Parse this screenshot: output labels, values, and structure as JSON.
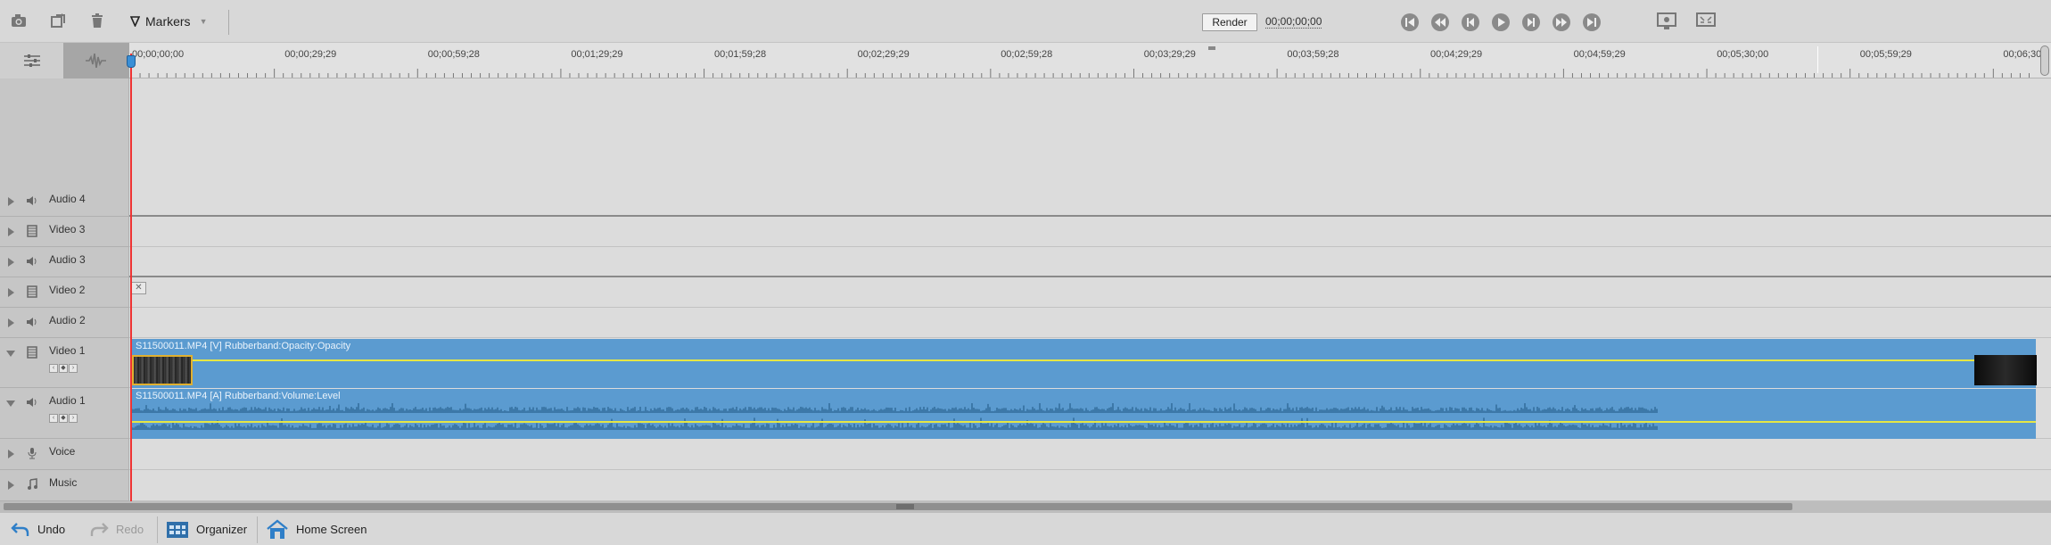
{
  "toolbar": {
    "markers_label": "Markers",
    "render_label": "Render",
    "timecode": "00;00;00;00"
  },
  "ruler": {
    "labels": [
      "00;00;00;00",
      "00;00;29;29",
      "00;00;59;28",
      "00;01;29;29",
      "00;01;59;28",
      "00;02;29;29",
      "00;02;59;28",
      "00;03;29;29",
      "00;03;59;28",
      "00;04;29;29",
      "00;04;59;29",
      "00;05;30;00",
      "00;05;59;29",
      "00;06;30;"
    ]
  },
  "tracks": {
    "audio4": "Audio 4",
    "video3": "Video 3",
    "audio3": "Audio 3",
    "video2": "Video 2",
    "audio2": "Audio 2",
    "video1": "Video 1",
    "audio1": "Audio 1",
    "voice": "Voice",
    "music": "Music"
  },
  "clips": {
    "video_clip": "S11500011.MP4 [V] Rubberband:Opacity:Opacity",
    "audio_clip": "S11500011.MP4 [A] Rubberband:Volume:Level"
  },
  "bottombar": {
    "undo": "Undo",
    "redo": "Redo",
    "organizer": "Organizer",
    "home": "Home Screen"
  },
  "colors": {
    "clip": "#5b9bd0",
    "rubberband": "#e6e644",
    "playhead": "#e33333",
    "home_icon": "#2f7fc8"
  }
}
